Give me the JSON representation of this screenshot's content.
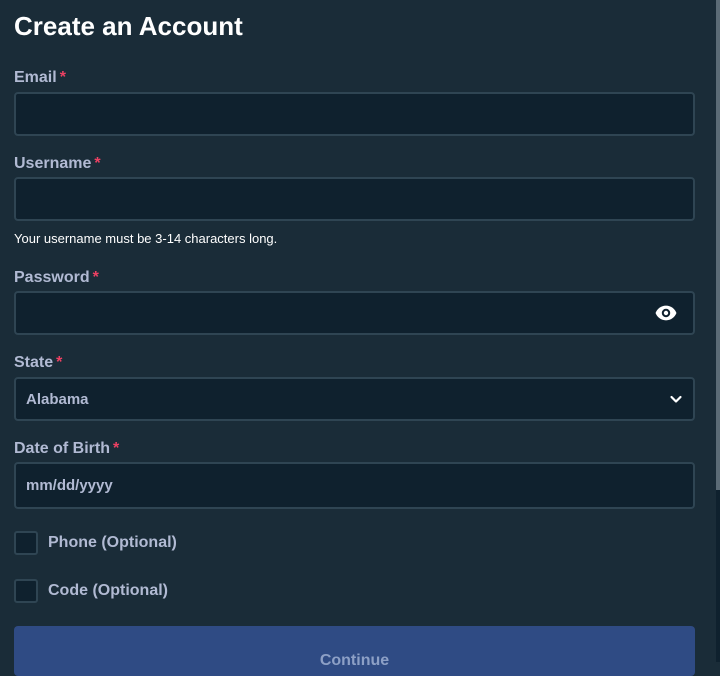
{
  "form": {
    "title": "Create an Account",
    "required_mark": "*",
    "email": {
      "label": "Email",
      "value": ""
    },
    "username": {
      "label": "Username",
      "value": "",
      "hint": "Your username must be 3-14 characters long."
    },
    "password": {
      "label": "Password",
      "value": "",
      "toggle_icon": "eye-icon"
    },
    "state": {
      "label": "State",
      "selected": "Alabama",
      "dropdown_icon": "chevron-down-icon"
    },
    "dob": {
      "label": "Date of Birth",
      "placeholder": "mm/dd/yyyy"
    },
    "phone_option": {
      "label": "Phone (Optional)",
      "checked": false
    },
    "code_option": {
      "label": "Code (Optional)",
      "checked": false
    },
    "continue_label": "Continue"
  },
  "colors": {
    "background": "#1a2c38",
    "input_background": "#0f212e",
    "border": "#2f4553",
    "label": "#b1bad3",
    "required": "#ed4163",
    "button": "#2f4b84"
  }
}
